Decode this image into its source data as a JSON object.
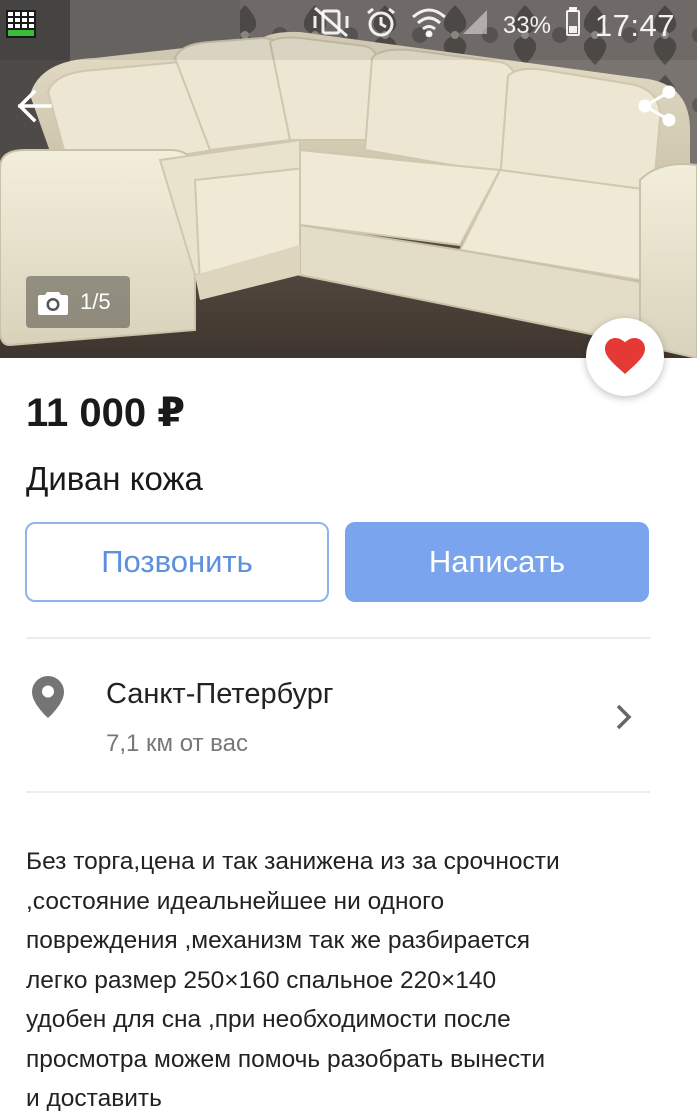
{
  "status_bar": {
    "battery_percent": "33%",
    "time": "17:47",
    "icons": [
      "app-grid-icon",
      "mute-vibrate-icon",
      "alarm-icon",
      "wifi-icon",
      "signal-icon",
      "battery-icon"
    ]
  },
  "gallery": {
    "counter": "1/5",
    "icons": {
      "back": "arrow-left-icon",
      "share": "share-icon",
      "camera": "camera-icon",
      "favorite": "heart-icon"
    }
  },
  "listing": {
    "price": "11 000 ₽",
    "title": "Диван кожа"
  },
  "actions": {
    "call_label": "Позвонить",
    "write_label": "Написать"
  },
  "location": {
    "city": "Санкт-Петербург",
    "distance": "7,1 км от вас"
  },
  "description": {
    "lines": [
      "Без торга,цена и так занижена из за срочности",
      ",состояние идеальнейшее ни одного",
      "повреждения ,механизм так же разбирается",
      "легко размер 250×160 спальное 220×140",
      "удобен для сна ,при необходимости после",
      "просмотра можем помочь разобрать вынести",
      "и доставить"
    ]
  },
  "colors": {
    "accent": "#7aa4ee",
    "accent_text": "#5c8fe0",
    "favorite": "#e53935"
  }
}
